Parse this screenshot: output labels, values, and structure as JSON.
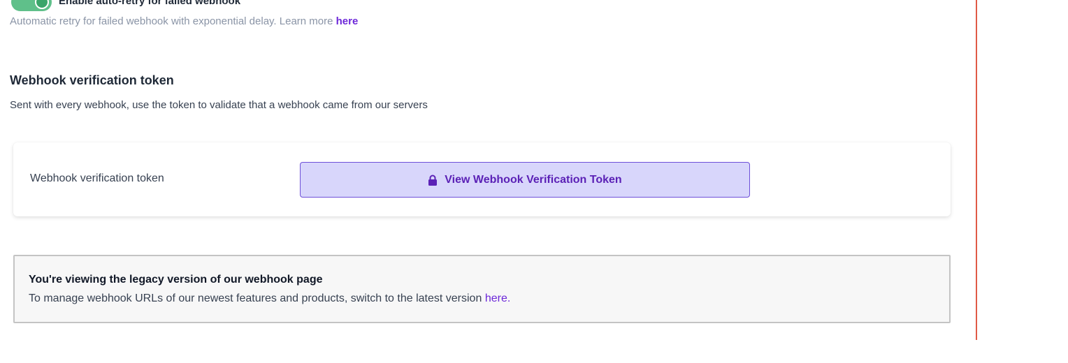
{
  "auto_retry": {
    "toggle_label": "Enable auto-retry for failed webhook",
    "description": "Automatic retry for failed webhook with exponential delay. Learn more",
    "learn_more_link": "here",
    "enabled": true
  },
  "verification": {
    "title": "Webhook verification token",
    "description": "Sent with every webhook, use the token to validate that a webhook came from our servers",
    "field_label": "Webhook verification token",
    "button_label": "View Webhook Verification Token",
    "button_icon": "lock-icon"
  },
  "legacy_notice": {
    "title": "You're viewing the legacy version of our webhook page",
    "description": "To manage webhook URLs of our newest features and products, switch to the latest version",
    "link": "here."
  },
  "colors": {
    "accent": "#6d28d9",
    "toggle_on": "#5fc08a",
    "divider": "#e05a47",
    "button_bg": "#d8d6fb"
  }
}
